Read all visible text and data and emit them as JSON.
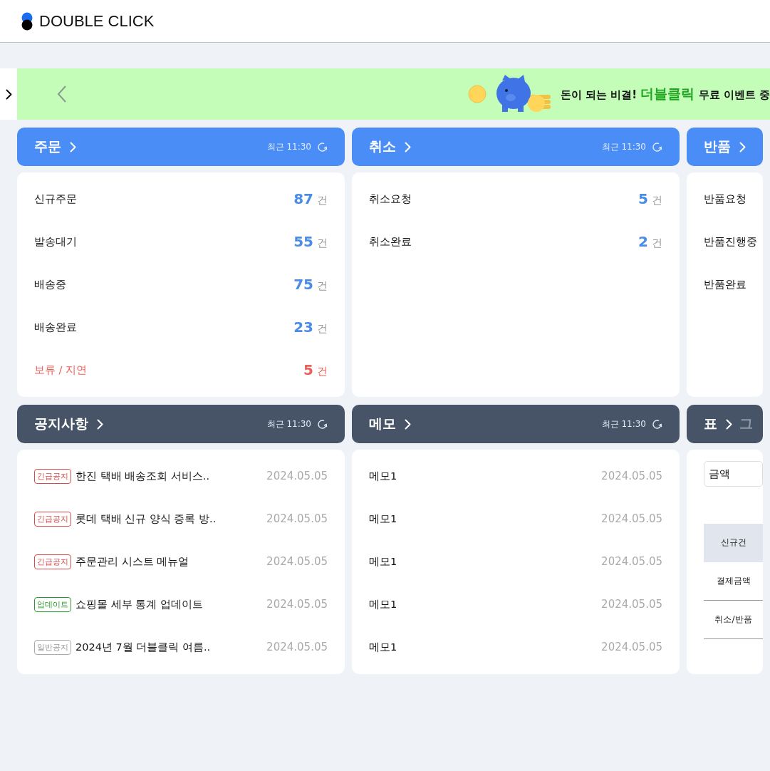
{
  "header": {
    "logo": "DOUBLE CLICK"
  },
  "banner": {
    "lead": "돈이 되는 비결!",
    "highlight": "더블클릭",
    "tail": "무료 이벤트 중"
  },
  "rows": [
    {
      "kind": "primary",
      "panels": [
        {
          "kind": "counts",
          "title": "주문",
          "updated": "최근 11:30",
          "items": [
            {
              "label": "신규주문",
              "count": "87",
              "unit": "건",
              "alert": false
            },
            {
              "label": "발송대기",
              "count": "55",
              "unit": "건",
              "alert": false
            },
            {
              "label": "배송중",
              "count": "75",
              "unit": "건",
              "alert": false
            },
            {
              "label": "배송완료",
              "count": "23",
              "unit": "건",
              "alert": false
            },
            {
              "label": "보류 / 지연",
              "count": "5",
              "unit": "건",
              "alert": true
            }
          ]
        },
        {
          "kind": "counts",
          "title": "취소",
          "updated": "최근 11:30",
          "items": [
            {
              "label": "취소요청",
              "count": "5",
              "unit": "건",
              "alert": false
            },
            {
              "label": "취소완료",
              "count": "2",
              "unit": "건",
              "alert": false
            }
          ]
        },
        {
          "kind": "counts",
          "title": "반품",
          "items": [
            {
              "label": "반품요청",
              "alert": false
            },
            {
              "label": "반품진행중",
              "alert": false
            },
            {
              "label": "반품완료",
              "alert": false
            }
          ]
        }
      ]
    },
    {
      "kind": "dark",
      "panels": [
        {
          "kind": "notices",
          "title": "공지사항",
          "updated": "최근 11:30",
          "items": [
            {
              "tag": "긴급공지",
              "kind": "urgent",
              "title": "한진 택배 배송조회 서비스..",
              "date": "2024.05.05"
            },
            {
              "tag": "긴급공지",
              "kind": "urgent",
              "title": "롯데 택배 신규 양식 증록 방..",
              "date": "2024.05.05"
            },
            {
              "tag": "긴급공지",
              "kind": "urgent",
              "title": "주문관리 시스트 메뉴얼",
              "date": "2024.05.05"
            },
            {
              "tag": "업데이트",
              "kind": "update",
              "title": "쇼핑몰 세부 통계 업데이트",
              "date": "2024.05.05"
            },
            {
              "tag": "일반공지",
              "kind": "general",
              "title": "2024년 7월 더블클릭 여름..",
              "date": "2024.05.05"
            }
          ]
        },
        {
          "kind": "memos",
          "title": "메모",
          "updated": "최근 11:30",
          "items": [
            {
              "title": "메모1",
              "date": "2024.05.05"
            },
            {
              "title": "메모1",
              "date": "2024.05.05"
            },
            {
              "title": "메모1",
              "date": "2024.05.05"
            },
            {
              "title": "메모1",
              "date": "2024.05.05"
            },
            {
              "title": "메모1",
              "date": "2024.05.05"
            }
          ]
        },
        {
          "kind": "table",
          "tabs": [
            {
              "label": "표",
              "selected": true
            },
            {
              "label": "그",
              "selected": false
            }
          ],
          "select": "금액",
          "table_rows": [
            {
              "label": "신규건",
              "kind": "head"
            },
            {
              "label": "결제금액",
              "kind": "body"
            },
            {
              "label": "취소/반품",
              "kind": "body"
            }
          ]
        }
      ]
    }
  ]
}
